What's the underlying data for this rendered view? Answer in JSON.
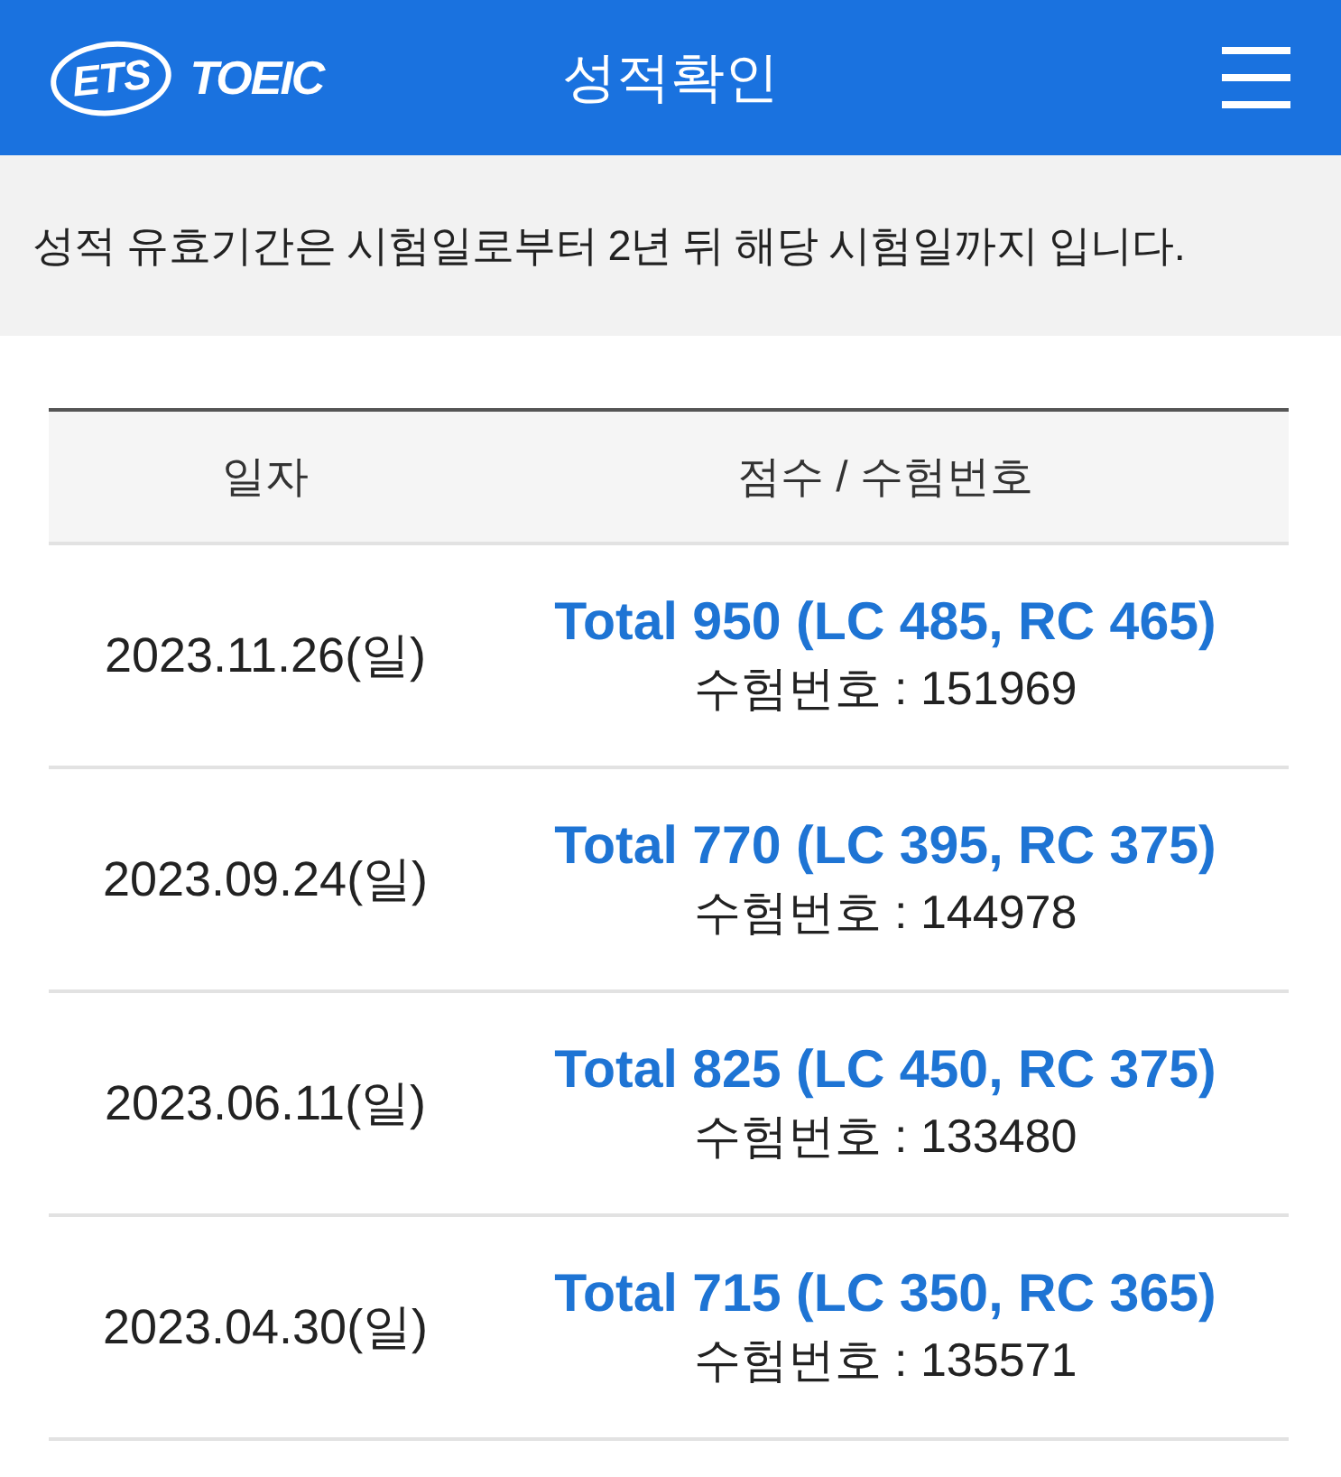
{
  "header": {
    "logo": {
      "mark": "ETS",
      "name": "TOEIC"
    },
    "title": "성적확인"
  },
  "notice": "성적 유효기간은 시험일로부터 2년 뒤 해당 시험일까지 입니다.",
  "table": {
    "columns": [
      "일자",
      "점수 / 수험번호"
    ],
    "rows": [
      {
        "date": "2023.11.26(일)",
        "score": "Total 950 (LC 485, RC 465)",
        "exam_number": "수험번호 : 151969"
      },
      {
        "date": "2023.09.24(일)",
        "score": "Total 770 (LC 395, RC 375)",
        "exam_number": "수험번호 : 144978"
      },
      {
        "date": "2023.06.11(일)",
        "score": "Total 825 (LC 450, RC 375)",
        "exam_number": "수험번호 : 133480"
      },
      {
        "date": "2023.04.30(일)",
        "score": "Total 715 (LC 350, RC 365)",
        "exam_number": "수험번호 : 135571"
      }
    ]
  }
}
